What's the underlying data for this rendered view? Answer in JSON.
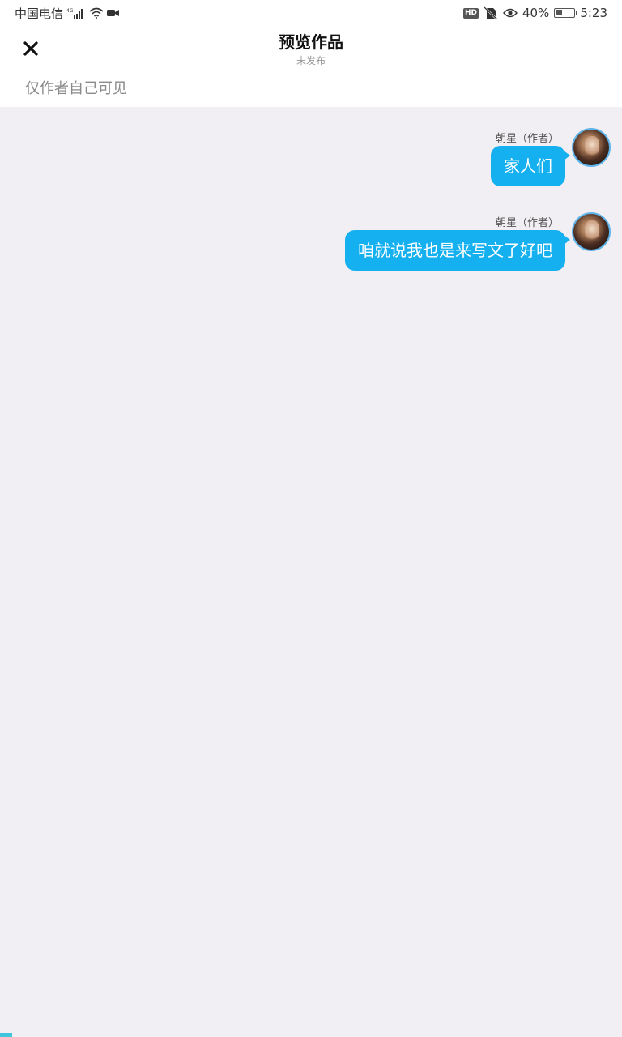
{
  "status_bar": {
    "carrier": "中国电信",
    "network": "4G",
    "battery_percent": "40%",
    "battery_level": 0.4,
    "time": "5:23",
    "hd": "HD",
    "icons": [
      "signal-icon",
      "wifi-icon",
      "video-icon",
      "hd-icon",
      "no-sim-icon",
      "eye-icon",
      "battery-icon"
    ]
  },
  "header": {
    "title": "预览作品",
    "subtitle": "未发布",
    "close_icon": "close-icon"
  },
  "visibility": {
    "label": "仅作者自己可见"
  },
  "messages": [
    {
      "author": "朝星（作者）",
      "text": "家人们"
    },
    {
      "author": "朝星（作者）",
      "text": "咱就说我也是来写文了好吧"
    }
  ],
  "colors": {
    "bubble": "#14b0ef",
    "background": "#f1eff3",
    "avatar_border": "#5fb4ea"
  }
}
